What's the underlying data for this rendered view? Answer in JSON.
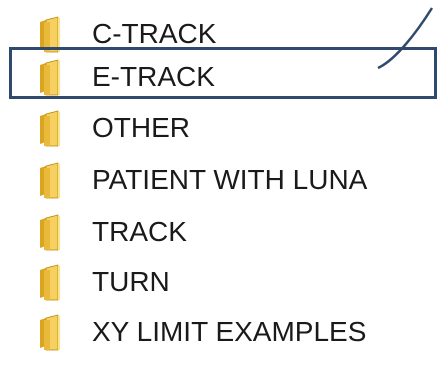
{
  "explorer": {
    "folders": [
      {
        "name": "C-TRACK",
        "icon": "folder-icon"
      },
      {
        "name": "E-TRACK",
        "icon": "folder-icon",
        "highlighted": true
      },
      {
        "name": "OTHER",
        "icon": "folder-icon"
      },
      {
        "name": "PATIENT WITH LUNA",
        "icon": "folder-icon"
      },
      {
        "name": "TRACK",
        "icon": "folder-icon"
      },
      {
        "name": "TURN",
        "icon": "folder-icon"
      },
      {
        "name": "XY LIMIT EXAMPLES",
        "icon": "folder-icon"
      }
    ]
  },
  "colors": {
    "highlight_border": "#2f4a6d",
    "folder_front": "#f2c94c",
    "folder_back": "#d9a520",
    "text": "#1a1a1a"
  }
}
